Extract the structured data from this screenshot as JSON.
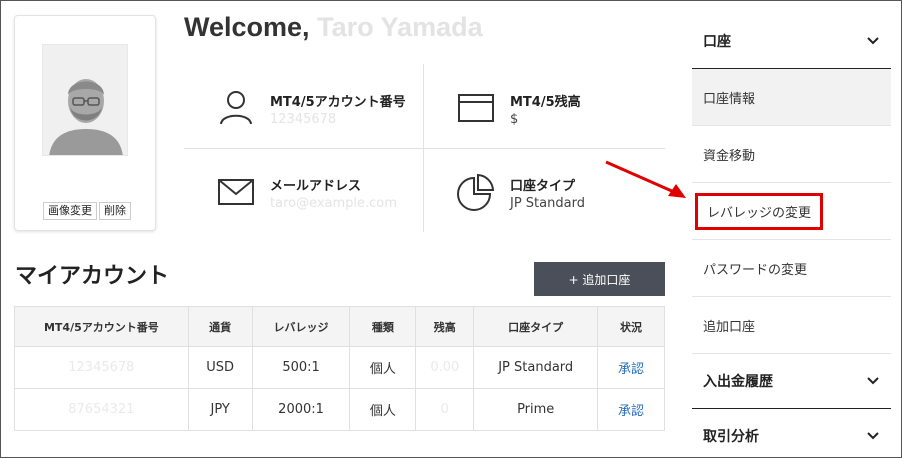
{
  "profile": {
    "change_image": "画像変更",
    "delete": "削除"
  },
  "welcome": {
    "prefix": "Welcome,",
    "name": "Taro Yamada"
  },
  "info": {
    "account_number_label": "MT4/5アカウント番号",
    "account_number_value": "12345678",
    "balance_label": "MT4/5残高",
    "balance_value": "$",
    "email_label": "メールアドレス",
    "email_value": "taro@example.com",
    "account_type_label": "口座タイプ",
    "account_type_value": "JP Standard"
  },
  "my_account": {
    "title": "マイアカウント",
    "add_button": "+ 追加口座",
    "columns": [
      "MT4/5アカウント番号",
      "通貨",
      "レバレッジ",
      "種類",
      "残高",
      "口座タイプ",
      "状況"
    ],
    "rows": [
      {
        "account": "12345678",
        "currency": "USD",
        "leverage": "500:1",
        "kind": "個人",
        "balance": "0.00",
        "type": "JP Standard",
        "status": "承認"
      },
      {
        "account": "87654321",
        "currency": "JPY",
        "leverage": "2000:1",
        "kind": "個人",
        "balance": "0",
        "type": "Prime",
        "status": "承認"
      }
    ]
  },
  "sidebar": {
    "section_account": "口座",
    "items": [
      "口座情報",
      "資金移動",
      "レバレッジの変更",
      "パスワードの変更",
      "追加口座"
    ],
    "section_history": "入出金履歴",
    "section_analysis": "取引分析"
  },
  "colors": {
    "button_bg": "#4a4f5a",
    "highlight": "#e00000",
    "status_link": "#2a6fbf"
  }
}
